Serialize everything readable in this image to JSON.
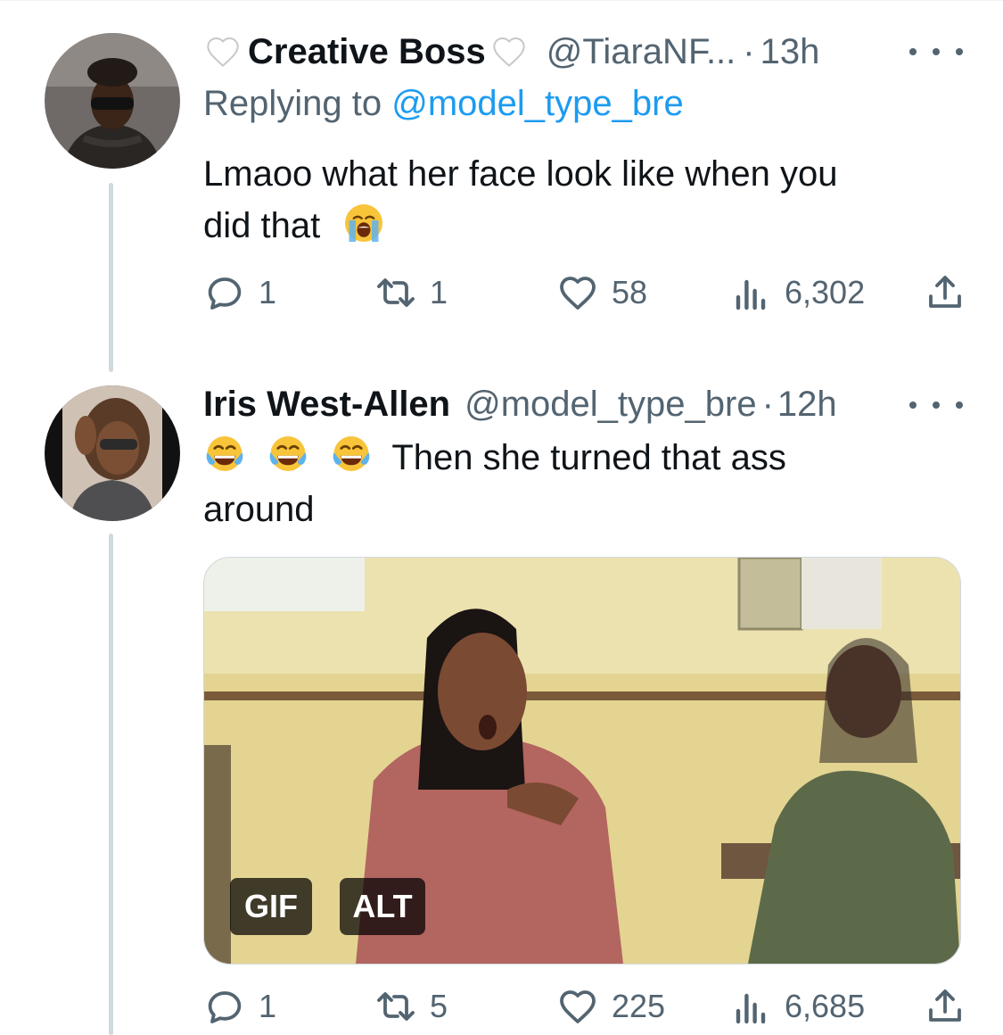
{
  "tweets": [
    {
      "display_name": "Creative Boss",
      "handle": "@TiaraNF...",
      "separator": "·",
      "time": "13h",
      "reply_prefix": "Replying to",
      "reply_to": "@model_type_bre",
      "text_line1": "Lmaoo what her face look like when you",
      "text_line2": "did that",
      "emoji": "loudly-crying-face",
      "actions": {
        "replies": "1",
        "retweets": "1",
        "likes": "58",
        "views": "6,302"
      }
    },
    {
      "display_name": "Iris West-Allen",
      "handle": "@model_type_bre",
      "separator": "·",
      "time": "12h",
      "text_line1": "Then she turned that ass",
      "text_line2": "around",
      "emoji": "face-with-tears-of-joy",
      "media": {
        "type": "gif",
        "gif_badge": "GIF",
        "alt_badge": "ALT"
      },
      "actions": {
        "replies": "1",
        "retweets": "5",
        "likes": "225",
        "views": "6,685"
      }
    }
  ],
  "colors": {
    "text": "#0f1419",
    "secondary": "#536471",
    "link": "#1d9bf0",
    "thread_line": "#cfd9de"
  },
  "icons": [
    "white-heart-icon",
    "more-icon",
    "reply-icon",
    "retweet-icon",
    "like-icon",
    "views-icon",
    "share-icon"
  ]
}
